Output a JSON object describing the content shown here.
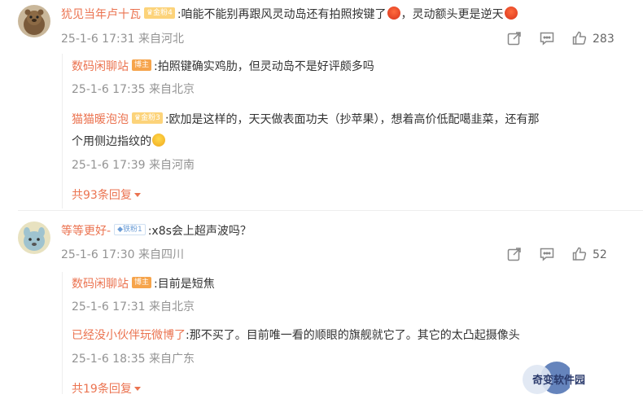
{
  "comments": [
    {
      "username": "犹见当年卢十瓦",
      "badge": "金粉4",
      "text_before": ":咱能不能别再跟风灵动岛还有拍照按键了",
      "text_mid": "，灵动额头更是逆天",
      "emojis": [
        "angry-emoji",
        "angry-emoji"
      ],
      "time": "25-1-6 17:31 来自河北",
      "likes": "283",
      "replies": [
        {
          "username": "数码闲聊站",
          "badge": "博主",
          "text": ":拍照键确实鸡肋，但灵动岛不是好评颇多吗",
          "time": "25-1-6 17:35 来自北京"
        },
        {
          "username": "猫猫暖泡泡",
          "badge": "金粉3",
          "text_line1": ":欧加是这样的，天天做表面功夫（抄苹果），想着高价低配噶韭菜，还有那",
          "text_line2": "个用侧边指纹的",
          "emoji": "laugh-emoji",
          "time": "25-1-6 17:39 来自河南"
        }
      ],
      "more_replies": "共93条回复"
    },
    {
      "username": "等等更好-",
      "badge": "铁粉1",
      "text": ":x8s会上超声波吗？",
      "time": "25-1-6 17:30 来自四川",
      "likes": "52",
      "replies": [
        {
          "username": "数码闲聊站",
          "badge": "博主",
          "text": ":目前是短焦",
          "time": "25-1-6 17:31 来自北京"
        },
        {
          "username": "已经没小伙伴玩微博了",
          "text": ":那不买了。目前唯一看的顺眼的旗舰就它了。其它的太凸起摄像头",
          "time": "25-1-6 18:35 来自广东"
        }
      ],
      "more_replies": "共19条回复"
    }
  ],
  "watermark": "奇变软件园",
  "colors": {
    "username": "#eb7350",
    "meta": "#939393",
    "text": "#333333"
  }
}
